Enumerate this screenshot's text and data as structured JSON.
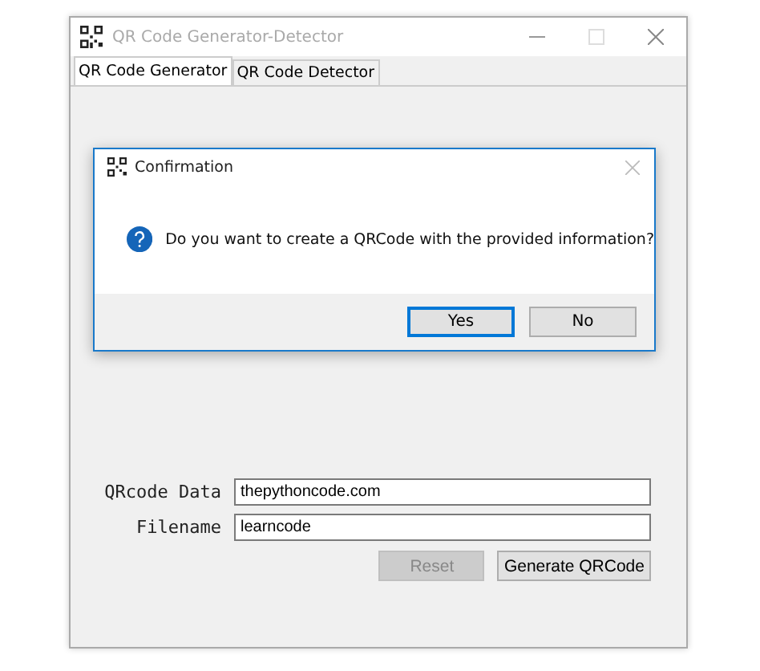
{
  "window": {
    "title": "QR Code Generator-Detector"
  },
  "tabs": [
    {
      "label": "QR Code Generator",
      "selected": true
    },
    {
      "label": "QR Code Detector",
      "selected": false
    }
  ],
  "form": {
    "fields": [
      {
        "label": "QRcode Data",
        "value": "thepythoncode.com"
      },
      {
        "label": "Filename",
        "value": "learncode"
      }
    ],
    "buttons": [
      {
        "label": "Reset",
        "disabled": true
      },
      {
        "label": "Generate QRCode",
        "disabled": false
      }
    ]
  },
  "dialog": {
    "title": "Confirmation",
    "message": "Do you want to create a QRCode with the provided information?",
    "buttons": [
      {
        "label": "Yes",
        "focused": true
      },
      {
        "label": "No",
        "focused": false
      }
    ]
  }
}
